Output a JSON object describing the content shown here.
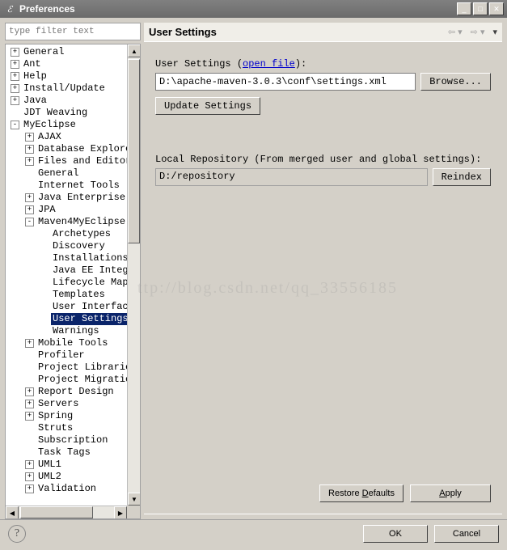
{
  "window": {
    "title": "Preferences"
  },
  "filter": {
    "placeholder": "type filter text"
  },
  "tree": [
    {
      "l": "General",
      "d": 0,
      "e": "+"
    },
    {
      "l": "Ant",
      "d": 0,
      "e": "+"
    },
    {
      "l": "Help",
      "d": 0,
      "e": "+"
    },
    {
      "l": "Install/Update",
      "d": 0,
      "e": "+"
    },
    {
      "l": "Java",
      "d": 0,
      "e": "+"
    },
    {
      "l": "JDT Weaving",
      "d": 0,
      "e": ""
    },
    {
      "l": "MyEclipse",
      "d": 0,
      "e": "-"
    },
    {
      "l": "AJAX",
      "d": 1,
      "e": "+"
    },
    {
      "l": "Database Explorer",
      "d": 1,
      "e": "+"
    },
    {
      "l": "Files and Editors",
      "d": 1,
      "e": "+"
    },
    {
      "l": "General",
      "d": 1,
      "e": ""
    },
    {
      "l": "Internet Tools",
      "d": 1,
      "e": ""
    },
    {
      "l": "Java Enterprise Pr",
      "d": 1,
      "e": "+"
    },
    {
      "l": "JPA",
      "d": 1,
      "e": "+"
    },
    {
      "l": "Maven4MyEclipse",
      "d": 1,
      "e": "-"
    },
    {
      "l": "Archetypes",
      "d": 2,
      "e": ""
    },
    {
      "l": "Discovery",
      "d": 2,
      "e": ""
    },
    {
      "l": "Installations",
      "d": 2,
      "e": ""
    },
    {
      "l": "Java EE Integra",
      "d": 2,
      "e": ""
    },
    {
      "l": "Lifecycle Mappi",
      "d": 2,
      "e": ""
    },
    {
      "l": "Templates",
      "d": 2,
      "e": ""
    },
    {
      "l": "User Interface",
      "d": 2,
      "e": ""
    },
    {
      "l": "User Settings",
      "d": 2,
      "e": "",
      "sel": true
    },
    {
      "l": "Warnings",
      "d": 2,
      "e": ""
    },
    {
      "l": "Mobile Tools",
      "d": 1,
      "e": "+"
    },
    {
      "l": "Profiler",
      "d": 1,
      "e": ""
    },
    {
      "l": "Project Libraries",
      "d": 1,
      "e": ""
    },
    {
      "l": "Project Migration",
      "d": 1,
      "e": ""
    },
    {
      "l": "Report Design",
      "d": 1,
      "e": "+"
    },
    {
      "l": "Servers",
      "d": 1,
      "e": "+"
    },
    {
      "l": "Spring",
      "d": 1,
      "e": "+"
    },
    {
      "l": "Struts",
      "d": 1,
      "e": ""
    },
    {
      "l": "Subscription",
      "d": 1,
      "e": ""
    },
    {
      "l": "Task Tags",
      "d": 1,
      "e": ""
    },
    {
      "l": "UML1",
      "d": 1,
      "e": "+"
    },
    {
      "l": "UML2",
      "d": 1,
      "e": "+"
    },
    {
      "l": "Validation",
      "d": 1,
      "e": "+"
    }
  ],
  "page": {
    "title": "User Settings",
    "userSettingsLabelPre": "User Settings (",
    "userSettingsLink": "open file",
    "userSettingsLabelPost": "):",
    "userSettingsPath": "D:\\apache-maven-3.0.3\\conf\\settings.xml",
    "browseBtn": "Browse...",
    "updateBtn": "Update Settings",
    "localRepoLabel": "Local Repository (From merged user and global settings):",
    "localRepoPath": "D:/repository",
    "reindexBtn": "Reindex",
    "restoreBtn": "Restore Defaults",
    "restoreBtnKey": "D",
    "applyBtn": "Apply",
    "applyBtnKey": "A"
  },
  "footer": {
    "ok": "OK",
    "cancel": "Cancel"
  },
  "watermark": "ttp://blog.csdn.net/qq_33556185"
}
